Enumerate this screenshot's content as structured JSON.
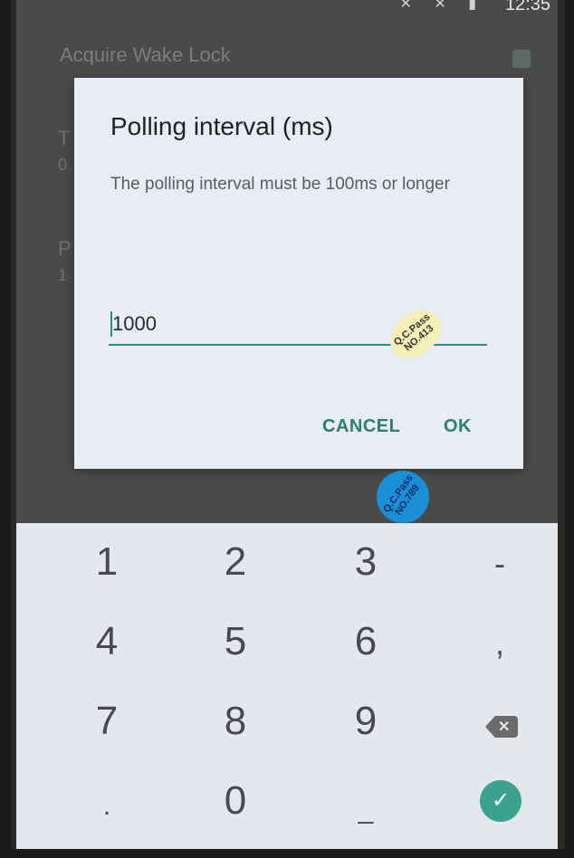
{
  "status_bar": {
    "time": "12:35",
    "icons": [
      "x",
      "x",
      "battery-icon"
    ]
  },
  "background_settings": {
    "wake_lock_title": "Acquire Wake Lock",
    "letter_1": "T",
    "letter_2": "0",
    "letter_3": "P",
    "letter_4": "1"
  },
  "dialog": {
    "title": "Polling interval (ms)",
    "message": "The polling interval must be 100ms or longer",
    "input_value": "1000",
    "cancel_label": "CANCEL",
    "ok_label": "OK"
  },
  "stickers": {
    "yellow": "Q.C.Pass NO.413",
    "blue": "Q.C.Pass NO.789"
  },
  "keypad": {
    "keys": [
      "1",
      "2",
      "3",
      "-",
      "4",
      "5",
      "6",
      ",",
      "7",
      "8",
      "9",
      "0",
      "."
    ],
    "backspace_icon": "backspace-icon",
    "done_icon": "check-icon"
  },
  "colors": {
    "accent": "#2d8d80",
    "dialog_bg": "#e8ecf4",
    "done_button": "#3aa38f"
  }
}
